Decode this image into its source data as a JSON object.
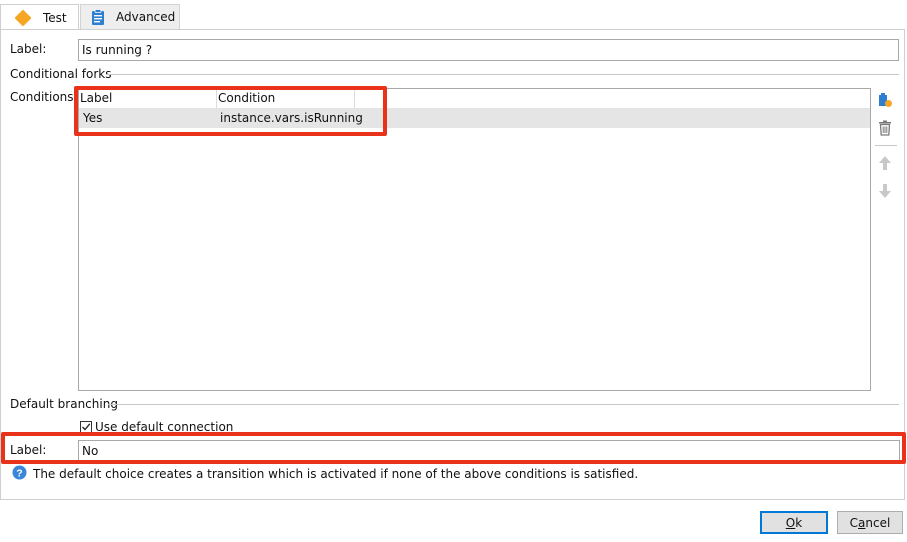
{
  "tabs": [
    {
      "label": "Test",
      "icon": "diamond-icon",
      "active": true
    },
    {
      "label": "Advanced",
      "icon": "clipboard-icon",
      "active": false
    }
  ],
  "label_field": {
    "caption": "Label:",
    "value": "Is running ?"
  },
  "conditional_forks": {
    "group_title": "Conditional forks",
    "conditions_caption": "Conditions:",
    "columns": [
      "Label",
      "Condition"
    ],
    "rows": [
      {
        "label": "Yes",
        "condition": "instance.vars.isRunning"
      }
    ]
  },
  "default_branching": {
    "group_title": "Default branching",
    "use_default_label": "Use default connection",
    "use_default_checked": true,
    "label_caption": "Label:",
    "label_value": "No",
    "info_text": "The default choice creates a transition which is activated if none of the above conditions is satisfied."
  },
  "buttons": {
    "ok": {
      "prefix": "",
      "mnemonic": "O",
      "rest": "k"
    },
    "cancel": {
      "prefix": "C",
      "mnemonic": "a",
      "rest": "ncel"
    }
  },
  "colors": {
    "highlight": "#e8321a",
    "accent": "#0078d7",
    "diamond": "#f5a623"
  }
}
